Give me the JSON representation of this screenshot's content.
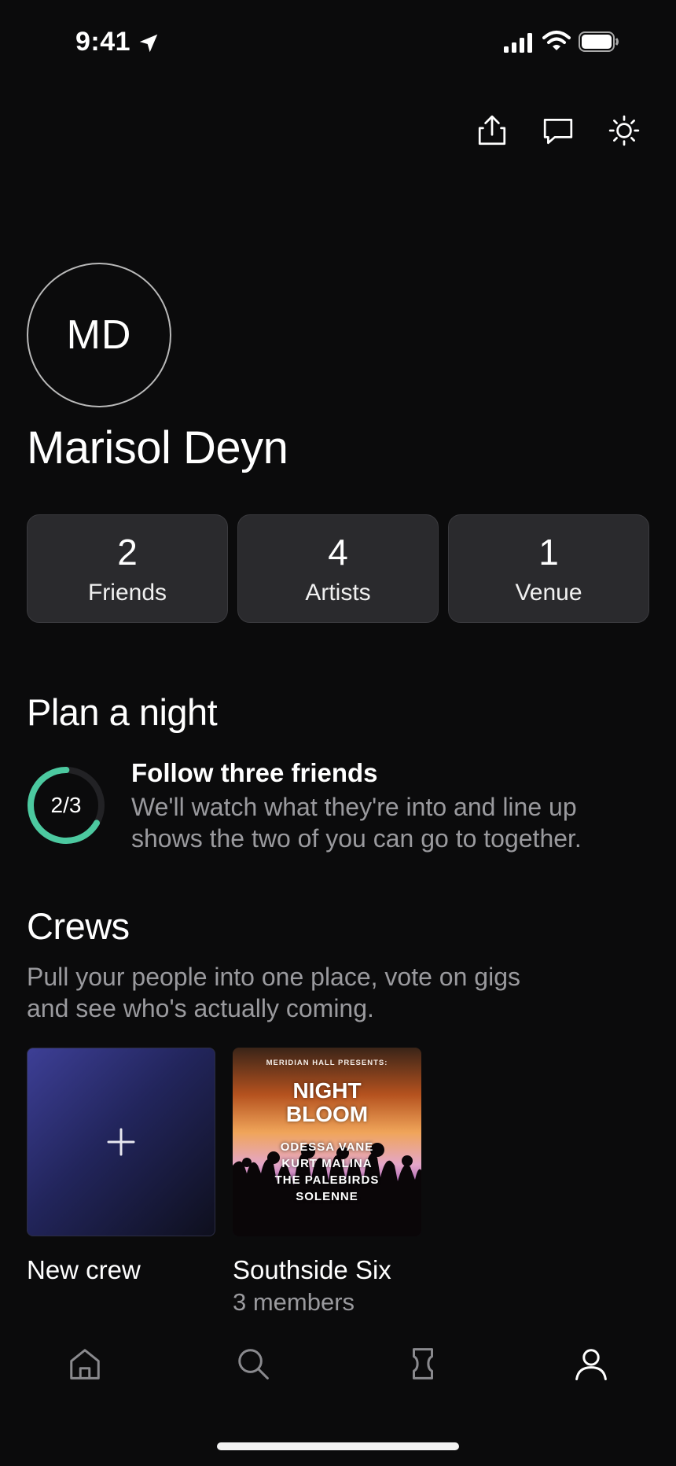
{
  "status_bar": {
    "time": "9:41"
  },
  "profile": {
    "initials": "MD",
    "name": "Marisol Deyn"
  },
  "stats": [
    {
      "number": "2",
      "label": "Friends"
    },
    {
      "number": "4",
      "label": "Artists"
    },
    {
      "number": "1",
      "label": "Venue"
    }
  ],
  "plan": {
    "title": "Plan a night",
    "progress_label": "2/3",
    "progress_fraction": 0.667,
    "progress_color": "#4cc9a0",
    "task_title": "Follow three friends",
    "task_desc": "We'll watch what they're into and line up shows the two of you can go to together."
  },
  "crews": {
    "title": "Crews",
    "desc": "Pull your people into one place, vote on gigs and see who's actually coming.",
    "new_label": "New crew",
    "items": [
      {
        "name": "Southside Six",
        "members": "3 members",
        "poster": {
          "kicker": "MERIDIAN HALL PRESENTS:",
          "title_line1": "NIGHT",
          "title_line2": "BLOOM",
          "lineup": [
            "ODESSA VANE",
            "KURT MALINA",
            "THE PALEBIRDS",
            "SOLENNE"
          ]
        }
      }
    ]
  },
  "icons": {
    "top": [
      "share-icon",
      "message-icon",
      "brightness-icon"
    ],
    "tabs": [
      "home-icon",
      "search-icon",
      "ticket-icon",
      "profile-icon"
    ]
  }
}
